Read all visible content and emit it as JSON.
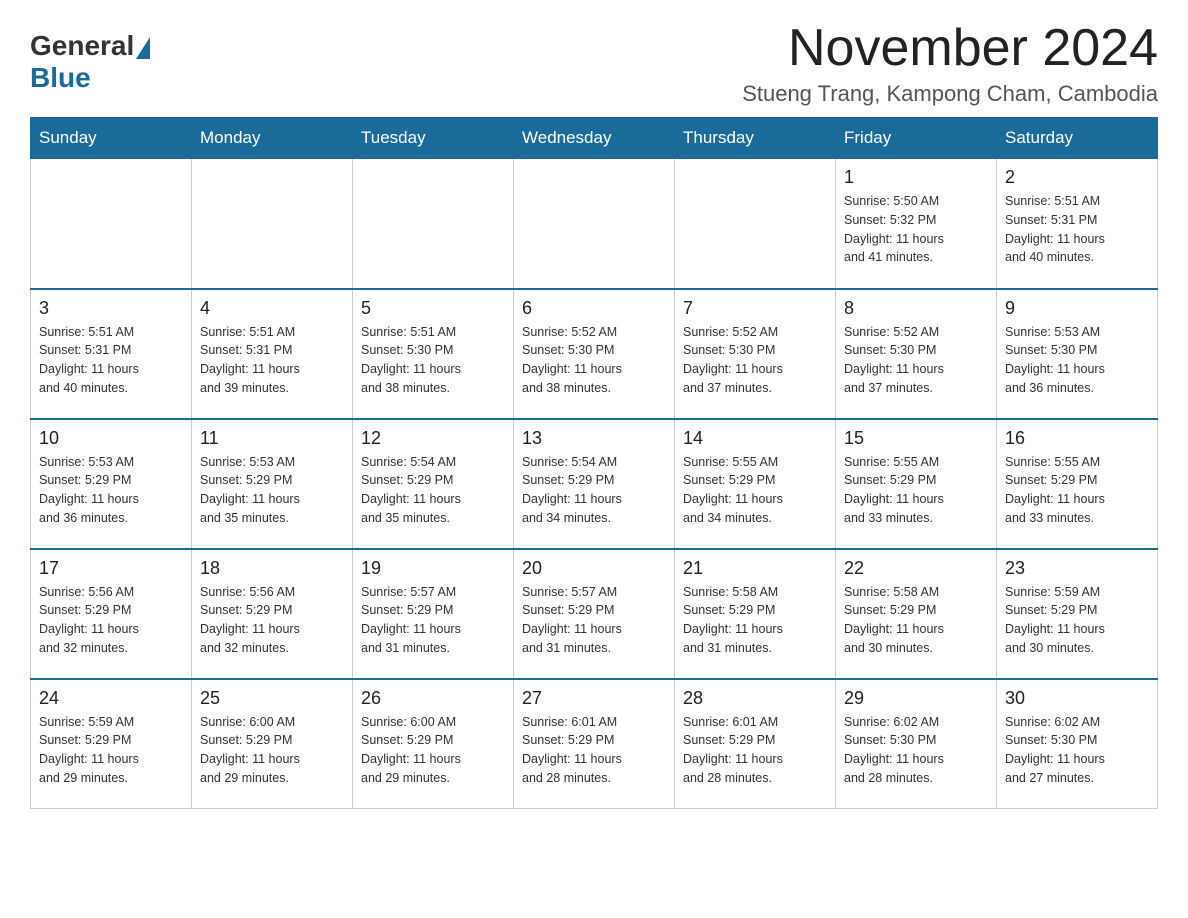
{
  "header": {
    "logo_general": "General",
    "logo_blue": "Blue",
    "month_title": "November 2024",
    "subtitle": "Stueng Trang, Kampong Cham, Cambodia"
  },
  "weekdays": [
    "Sunday",
    "Monday",
    "Tuesday",
    "Wednesday",
    "Thursday",
    "Friday",
    "Saturday"
  ],
  "weeks": [
    [
      {
        "day": "",
        "info": ""
      },
      {
        "day": "",
        "info": ""
      },
      {
        "day": "",
        "info": ""
      },
      {
        "day": "",
        "info": ""
      },
      {
        "day": "",
        "info": ""
      },
      {
        "day": "1",
        "info": "Sunrise: 5:50 AM\nSunset: 5:32 PM\nDaylight: 11 hours\nand 41 minutes."
      },
      {
        "day": "2",
        "info": "Sunrise: 5:51 AM\nSunset: 5:31 PM\nDaylight: 11 hours\nand 40 minutes."
      }
    ],
    [
      {
        "day": "3",
        "info": "Sunrise: 5:51 AM\nSunset: 5:31 PM\nDaylight: 11 hours\nand 40 minutes."
      },
      {
        "day": "4",
        "info": "Sunrise: 5:51 AM\nSunset: 5:31 PM\nDaylight: 11 hours\nand 39 minutes."
      },
      {
        "day": "5",
        "info": "Sunrise: 5:51 AM\nSunset: 5:30 PM\nDaylight: 11 hours\nand 38 minutes."
      },
      {
        "day": "6",
        "info": "Sunrise: 5:52 AM\nSunset: 5:30 PM\nDaylight: 11 hours\nand 38 minutes."
      },
      {
        "day": "7",
        "info": "Sunrise: 5:52 AM\nSunset: 5:30 PM\nDaylight: 11 hours\nand 37 minutes."
      },
      {
        "day": "8",
        "info": "Sunrise: 5:52 AM\nSunset: 5:30 PM\nDaylight: 11 hours\nand 37 minutes."
      },
      {
        "day": "9",
        "info": "Sunrise: 5:53 AM\nSunset: 5:30 PM\nDaylight: 11 hours\nand 36 minutes."
      }
    ],
    [
      {
        "day": "10",
        "info": "Sunrise: 5:53 AM\nSunset: 5:29 PM\nDaylight: 11 hours\nand 36 minutes."
      },
      {
        "day": "11",
        "info": "Sunrise: 5:53 AM\nSunset: 5:29 PM\nDaylight: 11 hours\nand 35 minutes."
      },
      {
        "day": "12",
        "info": "Sunrise: 5:54 AM\nSunset: 5:29 PM\nDaylight: 11 hours\nand 35 minutes."
      },
      {
        "day": "13",
        "info": "Sunrise: 5:54 AM\nSunset: 5:29 PM\nDaylight: 11 hours\nand 34 minutes."
      },
      {
        "day": "14",
        "info": "Sunrise: 5:55 AM\nSunset: 5:29 PM\nDaylight: 11 hours\nand 34 minutes."
      },
      {
        "day": "15",
        "info": "Sunrise: 5:55 AM\nSunset: 5:29 PM\nDaylight: 11 hours\nand 33 minutes."
      },
      {
        "day": "16",
        "info": "Sunrise: 5:55 AM\nSunset: 5:29 PM\nDaylight: 11 hours\nand 33 minutes."
      }
    ],
    [
      {
        "day": "17",
        "info": "Sunrise: 5:56 AM\nSunset: 5:29 PM\nDaylight: 11 hours\nand 32 minutes."
      },
      {
        "day": "18",
        "info": "Sunrise: 5:56 AM\nSunset: 5:29 PM\nDaylight: 11 hours\nand 32 minutes."
      },
      {
        "day": "19",
        "info": "Sunrise: 5:57 AM\nSunset: 5:29 PM\nDaylight: 11 hours\nand 31 minutes."
      },
      {
        "day": "20",
        "info": "Sunrise: 5:57 AM\nSunset: 5:29 PM\nDaylight: 11 hours\nand 31 minutes."
      },
      {
        "day": "21",
        "info": "Sunrise: 5:58 AM\nSunset: 5:29 PM\nDaylight: 11 hours\nand 31 minutes."
      },
      {
        "day": "22",
        "info": "Sunrise: 5:58 AM\nSunset: 5:29 PM\nDaylight: 11 hours\nand 30 minutes."
      },
      {
        "day": "23",
        "info": "Sunrise: 5:59 AM\nSunset: 5:29 PM\nDaylight: 11 hours\nand 30 minutes."
      }
    ],
    [
      {
        "day": "24",
        "info": "Sunrise: 5:59 AM\nSunset: 5:29 PM\nDaylight: 11 hours\nand 29 minutes."
      },
      {
        "day": "25",
        "info": "Sunrise: 6:00 AM\nSunset: 5:29 PM\nDaylight: 11 hours\nand 29 minutes."
      },
      {
        "day": "26",
        "info": "Sunrise: 6:00 AM\nSunset: 5:29 PM\nDaylight: 11 hours\nand 29 minutes."
      },
      {
        "day": "27",
        "info": "Sunrise: 6:01 AM\nSunset: 5:29 PM\nDaylight: 11 hours\nand 28 minutes."
      },
      {
        "day": "28",
        "info": "Sunrise: 6:01 AM\nSunset: 5:29 PM\nDaylight: 11 hours\nand 28 minutes."
      },
      {
        "day": "29",
        "info": "Sunrise: 6:02 AM\nSunset: 5:30 PM\nDaylight: 11 hours\nand 28 minutes."
      },
      {
        "day": "30",
        "info": "Sunrise: 6:02 AM\nSunset: 5:30 PM\nDaylight: 11 hours\nand 27 minutes."
      }
    ]
  ]
}
